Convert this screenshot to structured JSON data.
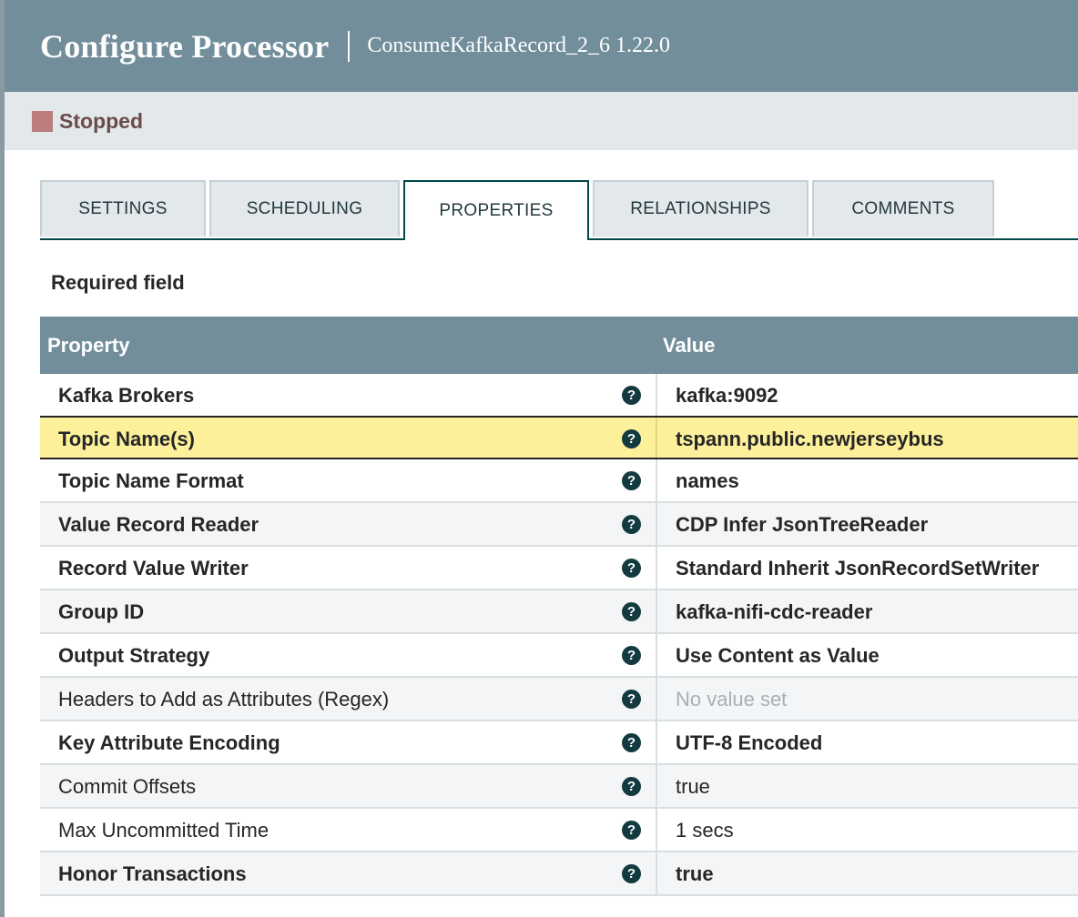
{
  "header": {
    "title": "Configure Processor",
    "subtitle": "ConsumeKafkaRecord_2_6 1.22.0"
  },
  "status": {
    "label": "Stopped",
    "color": "#ba7c7c"
  },
  "tabs": [
    {
      "label": "SETTINGS",
      "active": false
    },
    {
      "label": "SCHEDULING",
      "active": false
    },
    {
      "label": "PROPERTIES",
      "active": true
    },
    {
      "label": "RELATIONSHIPS",
      "active": false
    },
    {
      "label": "COMMENTS",
      "active": false
    }
  ],
  "required_label": "Required field",
  "table": {
    "columns": {
      "property": "Property",
      "value": "Value"
    },
    "rows": [
      {
        "name": "Kafka Brokers",
        "required": true,
        "value": "kafka:9092",
        "value_bold": true,
        "selected": false
      },
      {
        "name": "Topic Name(s)",
        "required": true,
        "value": "tspann.public.newjerseybus",
        "value_bold": true,
        "selected": true
      },
      {
        "name": "Topic Name Format",
        "required": true,
        "value": "names",
        "value_bold": true,
        "selected": false
      },
      {
        "name": "Value Record Reader",
        "required": true,
        "value": "CDP Infer JsonTreeReader",
        "value_bold": true,
        "selected": false
      },
      {
        "name": "Record Value Writer",
        "required": true,
        "value": "Standard Inherit JsonRecordSetWriter",
        "value_bold": true,
        "selected": false
      },
      {
        "name": "Group ID",
        "required": true,
        "value": "kafka-nifi-cdc-reader",
        "value_bold": true,
        "selected": false
      },
      {
        "name": "Output Strategy",
        "required": true,
        "value": "Use Content as Value",
        "value_bold": true,
        "selected": false
      },
      {
        "name": "Headers to Add as Attributes (Regex)",
        "required": false,
        "value": "No value set",
        "value_bold": false,
        "empty": true,
        "selected": false
      },
      {
        "name": "Key Attribute Encoding",
        "required": true,
        "value": "UTF-8 Encoded",
        "value_bold": true,
        "selected": false
      },
      {
        "name": "Commit Offsets",
        "required": false,
        "value": "true",
        "value_bold": false,
        "selected": false
      },
      {
        "name": "Max Uncommitted Time",
        "required": false,
        "value": "1 secs",
        "value_bold": false,
        "selected": false
      },
      {
        "name": "Honor Transactions",
        "required": true,
        "value": "true",
        "value_bold": true,
        "selected": false
      }
    ]
  },
  "help_glyph": "?",
  "icons": {
    "help": "question-circle-icon",
    "status": "stopped-square-icon"
  }
}
